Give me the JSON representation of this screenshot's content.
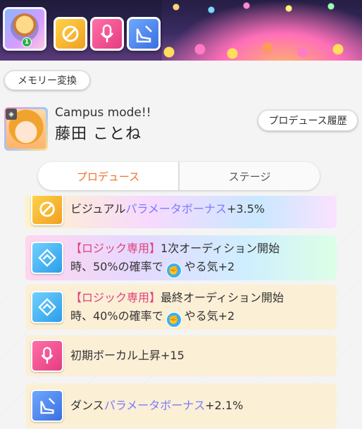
{
  "header": {
    "icons": [
      {
        "name": "produce-card-icon",
        "badge": "1"
      },
      {
        "name": "visual-icon"
      },
      {
        "name": "vocal-icon"
      },
      {
        "name": "dance-icon"
      }
    ]
  },
  "memory_button": {
    "label": "メモリー変換"
  },
  "character": {
    "mode": "Campus mode!!",
    "name": "藤田 ことね"
  },
  "history_button": {
    "label": "プロデュース履歴"
  },
  "tabs": [
    {
      "label": "プロデュース",
      "active": true
    },
    {
      "label": "ステージ",
      "active": false
    }
  ],
  "abilities": [
    {
      "icon": "visual-icon",
      "parts": [
        "ビジュアル",
        "パラメータボーナス",
        "+3.5%"
      ]
    },
    {
      "icon": "logic-icon",
      "tag": "【ロジック専用】",
      "line1": "1次オーディション開始",
      "line2_pre": "時、50%の確率で",
      "line2_post": "やる気+2"
    },
    {
      "icon": "logic-icon",
      "tag": "【ロジック専用】",
      "line1": "最終オーディション開始",
      "line2_pre": "時、40%の確率で",
      "line2_post": "やる気+2"
    },
    {
      "icon": "vocal-icon",
      "text": "初期ボーカル上昇+15"
    },
    {
      "icon": "dance-icon",
      "parts": [
        "ダンス",
        "パラメータボーナス",
        "+2.1%"
      ]
    }
  ],
  "colors": {
    "accent_tab": "#f07020",
    "param_bonus": "#7a7aff",
    "logic_tag": "#e0407a"
  }
}
